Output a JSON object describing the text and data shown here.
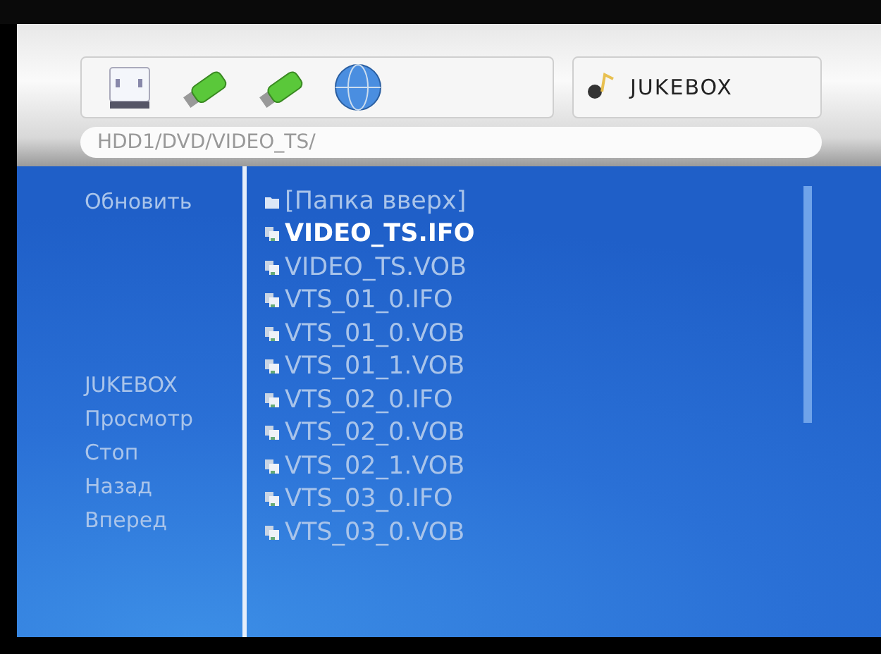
{
  "devices": [
    {
      "kind": "hdd"
    },
    {
      "kind": "usb"
    },
    {
      "kind": "usb"
    },
    {
      "kind": "network"
    }
  ],
  "mode_button": {
    "label": "JUKEBOX"
  },
  "path": "HDD1/DVD/VIDEO_TS/",
  "menu_top": [
    "Обновить"
  ],
  "menu_bottom": [
    "JUKEBOX",
    "Просмотр",
    "Стоп",
    "Назад",
    "Вперед"
  ],
  "files": [
    {
      "name": "[Папка вверх]",
      "kind": "folder",
      "selected": false
    },
    {
      "name": "VIDEO_TS.IFO",
      "kind": "file",
      "selected": true
    },
    {
      "name": "VIDEO_TS.VOB",
      "kind": "file",
      "selected": false
    },
    {
      "name": "VTS_01_0.IFO",
      "kind": "file",
      "selected": false
    },
    {
      "name": "VTS_01_0.VOB",
      "kind": "file",
      "selected": false
    },
    {
      "name": "VTS_01_1.VOB",
      "kind": "file",
      "selected": false
    },
    {
      "name": "VTS_02_0.IFO",
      "kind": "file",
      "selected": false
    },
    {
      "name": "VTS_02_0.VOB",
      "kind": "file",
      "selected": false
    },
    {
      "name": "VTS_02_1.VOB",
      "kind": "file",
      "selected": false
    },
    {
      "name": "VTS_03_0.IFO",
      "kind": "file",
      "selected": false
    },
    {
      "name": "VTS_03_0.VOB",
      "kind": "file",
      "selected": false
    }
  ]
}
